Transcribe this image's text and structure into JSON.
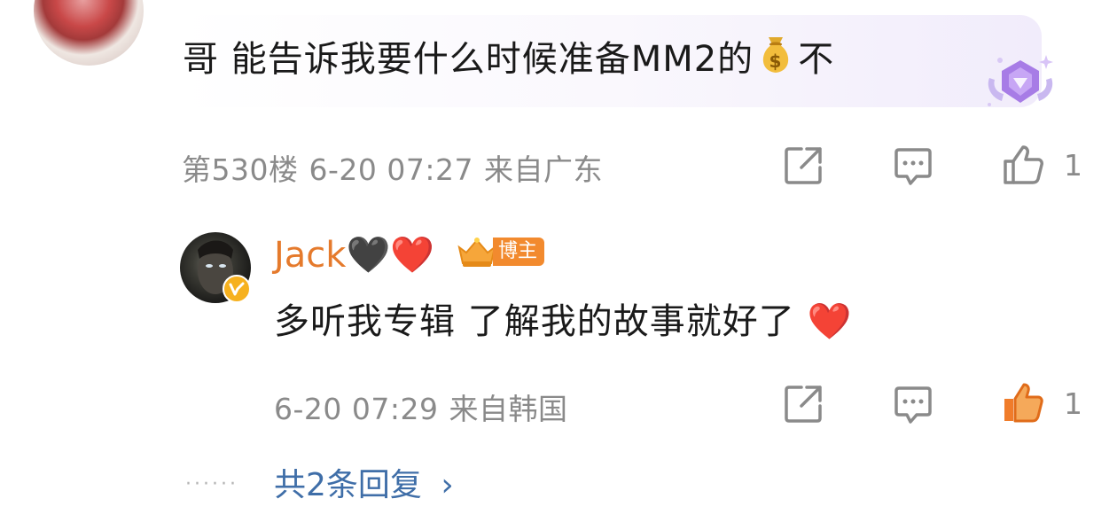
{
  "top_comment": {
    "text_before_emoji": "哥 能告诉我要什么时候准备MM2的",
    "emoji": "money-bag-emoji",
    "text_after_emoji": "不",
    "badge": "gem-badge-icon",
    "floor": "第530楼",
    "timestamp": "6-20 07:27",
    "location": "来自广东",
    "like_count": "1"
  },
  "reply": {
    "author": "Jack",
    "author_emojis": "🖤❤️",
    "role_tag": "博主",
    "text": "多听我专辑 了解我的故事就好了",
    "text_emoji": "❤️",
    "timestamp": "6-20 07:29",
    "location": "来自韩国",
    "like_count": "1"
  },
  "more_replies": {
    "dots": "······",
    "label": "共2条回复",
    "chevron": "›"
  },
  "colors": {
    "accent_name": "#e57a2c",
    "link_blue": "#3f6ea8",
    "liked_orange": "#f07c2a",
    "meta_gray": "#8a8a8a"
  }
}
